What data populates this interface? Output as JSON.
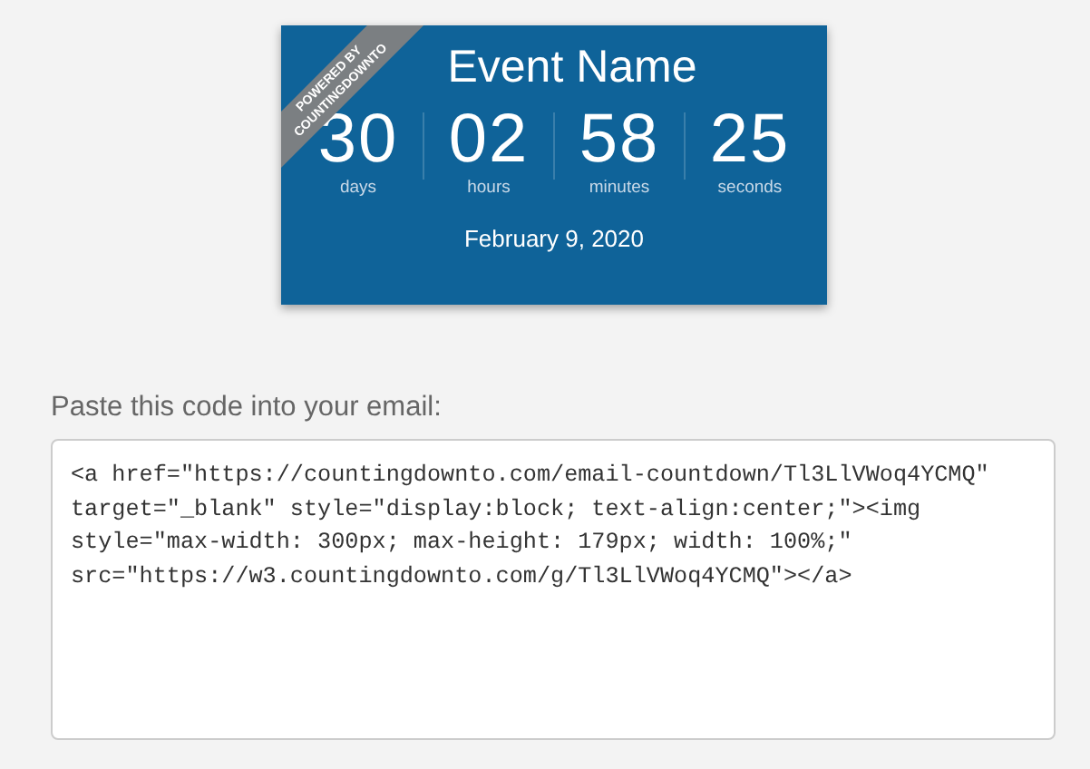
{
  "countdown_card": {
    "ribbon": [
      "POWERED BY",
      "COUNTINGDOWNTO"
    ],
    "title": "Event Name",
    "units": [
      {
        "value": "30",
        "label": "days"
      },
      {
        "value": "02",
        "label": "hours"
      },
      {
        "value": "58",
        "label": "minutes"
      },
      {
        "value": "25",
        "label": "seconds"
      }
    ],
    "date": "February 9, 2020"
  },
  "embed": {
    "label": "Paste this code into your email:",
    "code": "<a href=\"https://countingdownto.com/email-countdown/Tl3LlVWoq4YCMQ\" target=\"_blank\" style=\"display:block; text-align:center;\"><img style=\"max-width: 300px; max-height: 179px; width: 100%;\" src=\"https://w3.countingdownto.com/g/Tl3LlVWoq4YCMQ\"></a>"
  }
}
